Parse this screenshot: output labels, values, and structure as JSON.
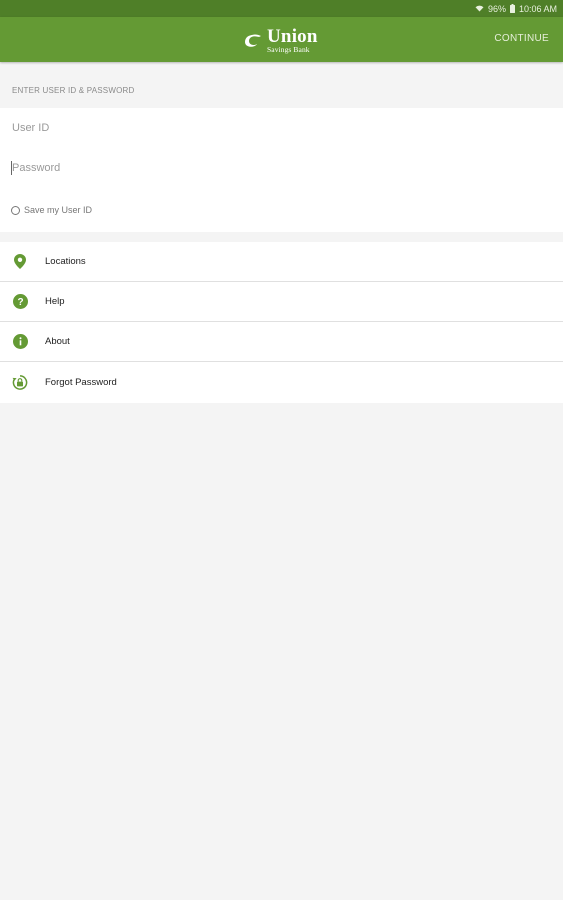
{
  "status_bar": {
    "battery": "96%",
    "time": "10:06 AM",
    "icons": [
      "wifi-icon",
      "battery-icon"
    ]
  },
  "app_bar": {
    "logo": {
      "name": "Union",
      "sub": "Savings Bank"
    },
    "continue_label": "CONTINUE"
  },
  "login": {
    "section_title": "ENTER USER ID & PASSWORD",
    "user_id_placeholder": "User ID",
    "password_placeholder": "Password",
    "save_user_id_label": "Save my User ID",
    "save_user_id_checked": false
  },
  "menu": {
    "items": [
      {
        "label": "Locations",
        "icon": "location-pin-icon"
      },
      {
        "label": "Help",
        "icon": "help-icon"
      },
      {
        "label": "About",
        "icon": "info-icon"
      },
      {
        "label": "Forgot Password",
        "icon": "lock-reset-icon"
      }
    ]
  },
  "colors": {
    "brand": "#649a34",
    "status_bar": "#4f7f28",
    "background": "#f4f4f4"
  }
}
